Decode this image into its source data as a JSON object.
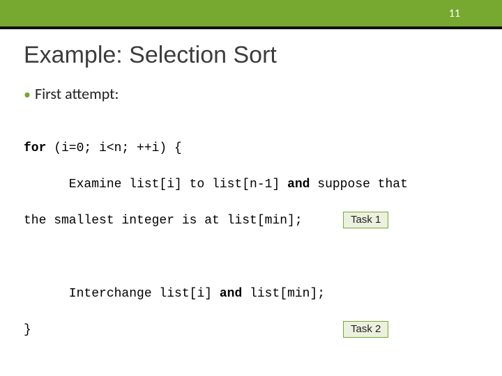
{
  "header": {
    "page_number": "11"
  },
  "title": "Example: Selection Sort",
  "bullet": "First attempt:",
  "code": {
    "l1a": "for",
    "l1b": " (i=0; i<n; ++i) {",
    "l2a": "      Examine list[i] to list[n-1] ",
    "l2b": "and",
    "l2c": " suppose that",
    "l3": "the smallest integer is at list[min]; ",
    "blank": " ",
    "l4a": "      Interchange list[i] ",
    "l4b": "and",
    "l4c": " list[min];",
    "l5": "}"
  },
  "badges": {
    "task1": "Task 1",
    "task2": "Task 2"
  },
  "colors": {
    "accent": "#77a82f",
    "badge_bg": "#ebf1de"
  }
}
